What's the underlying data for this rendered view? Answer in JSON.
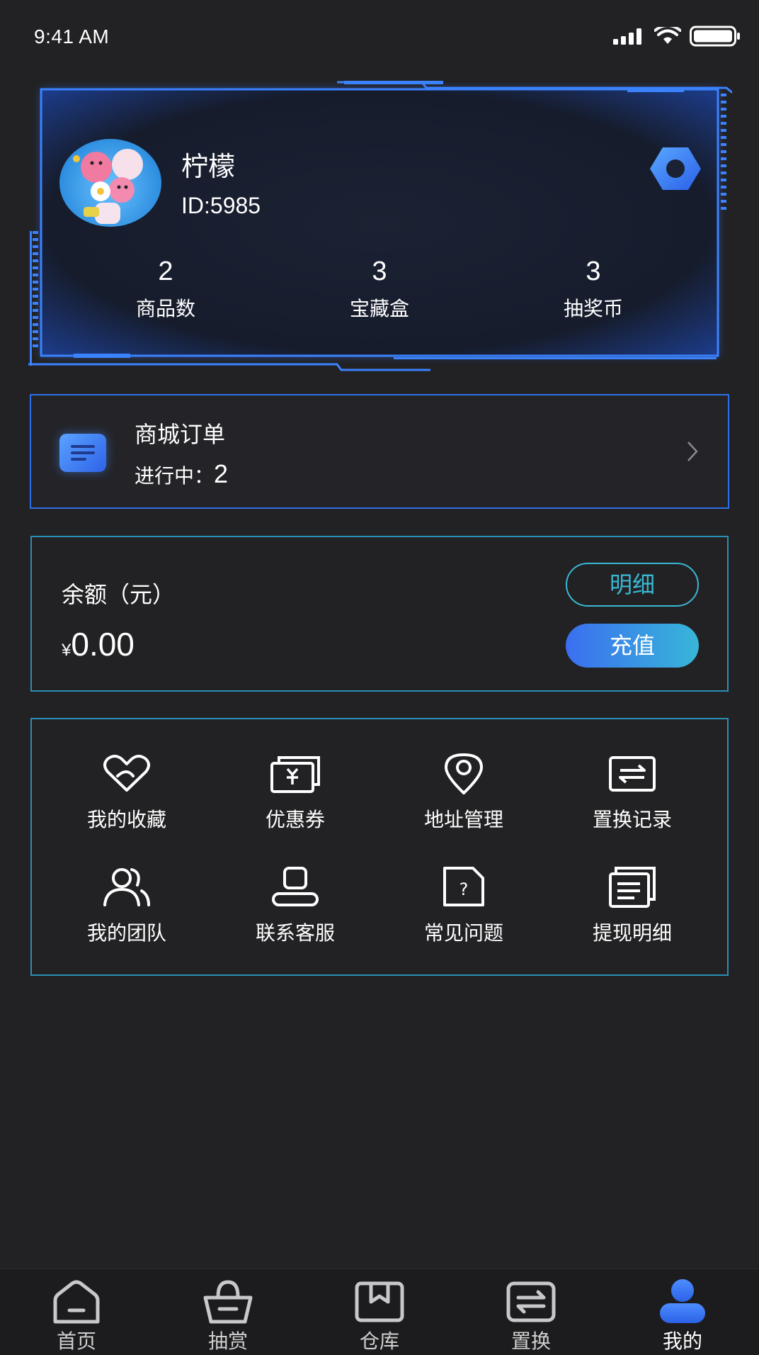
{
  "status_bar": {
    "time": "9:41 AM"
  },
  "profile": {
    "name": "柠檬",
    "id_text": "ID:5985",
    "stats": [
      {
        "value": "2",
        "label": "商品数"
      },
      {
        "value": "3",
        "label": "宝藏盒"
      },
      {
        "value": "3",
        "label": "抽奖币"
      }
    ]
  },
  "order": {
    "title": "商城订单",
    "status_label": "进行中：",
    "status_count": "2"
  },
  "balance": {
    "label": "余额（元）",
    "currency": "¥",
    "amount": "0.00",
    "detail_button": "明细",
    "recharge_button": "充值"
  },
  "menu": {
    "items": [
      {
        "label": "我的收藏",
        "icon": "heart-icon"
      },
      {
        "label": "优惠券",
        "icon": "coupon-icon"
      },
      {
        "label": "地址管理",
        "icon": "location-pin-icon"
      },
      {
        "label": "置换记录",
        "icon": "exchange-record-icon"
      },
      {
        "label": "我的团队",
        "icon": "team-icon"
      },
      {
        "label": "联系客服",
        "icon": "customer-service-icon"
      },
      {
        "label": "常见问题",
        "icon": "faq-icon"
      },
      {
        "label": "提现明细",
        "icon": "withdrawal-detail-icon"
      }
    ]
  },
  "tab_bar": {
    "tabs": [
      {
        "label": "首页",
        "icon": "home-icon"
      },
      {
        "label": "抽赏",
        "icon": "basket-icon"
      },
      {
        "label": "仓库",
        "icon": "warehouse-icon"
      },
      {
        "label": "置换",
        "icon": "exchange-icon"
      },
      {
        "label": "我的",
        "icon": "profile-icon"
      }
    ],
    "active": "我的"
  },
  "colors": {
    "background": "#222224",
    "accent_blue": "#2f6fe6",
    "accent_cyan": "#3ab8d4",
    "tab_active": "#3a7cf0"
  }
}
